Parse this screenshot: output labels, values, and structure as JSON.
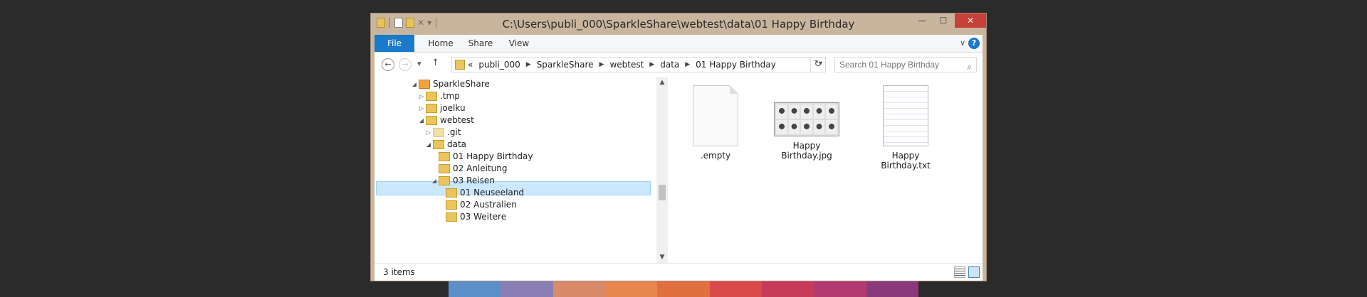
{
  "window": {
    "title": "C:\\Users\\publi_000\\SparkleShare\\webtest\\data\\01 Happy Birthday",
    "controls": {
      "minimize": "—",
      "maximize": "☐",
      "close": "✕"
    }
  },
  "ribbon": {
    "tabs": [
      {
        "label": "File"
      },
      {
        "label": "Home"
      },
      {
        "label": "Share"
      },
      {
        "label": "View"
      }
    ],
    "help": "?"
  },
  "navigation": {
    "breadcrumbs": [
      "«",
      "publi_000",
      "SparkleShare",
      "webtest",
      "data",
      "01 Happy Birthday"
    ],
    "search_placeholder": "Search 01 Happy Birthday"
  },
  "tree": {
    "items": [
      {
        "label": "SparkleShare",
        "expanded": true
      },
      {
        "label": ".tmp",
        "expanded": false
      },
      {
        "label": "joelku",
        "expanded": false
      },
      {
        "label": "webtest",
        "expanded": true
      },
      {
        "label": ".git",
        "expanded": false
      },
      {
        "label": "data",
        "expanded": true
      },
      {
        "label": "01 Happy Birthday",
        "selected": true
      },
      {
        "label": "02 Anleitung"
      },
      {
        "label": "03 Reisen",
        "expanded": true
      },
      {
        "label": "01 Neuseeland"
      },
      {
        "label": "02 Australien"
      },
      {
        "label": "03 Weitere"
      }
    ]
  },
  "files": [
    {
      "name": ".empty",
      "icon": "blank-file-icon"
    },
    {
      "name": "Happy Birthday.jpg",
      "line1": "Happy",
      "line2": "Birthday.jpg",
      "icon": "image-thumbnail"
    },
    {
      "name": "Happy Birthday.txt",
      "line1": "Happy",
      "line2": "Birthday.txt",
      "icon": "text-file-icon"
    }
  ],
  "status": {
    "item_count": "3 items"
  },
  "colors": {
    "accent": "#1979ca",
    "selection": "#cce8ff",
    "frame": "#c9b59e",
    "close": "#c7403a"
  }
}
